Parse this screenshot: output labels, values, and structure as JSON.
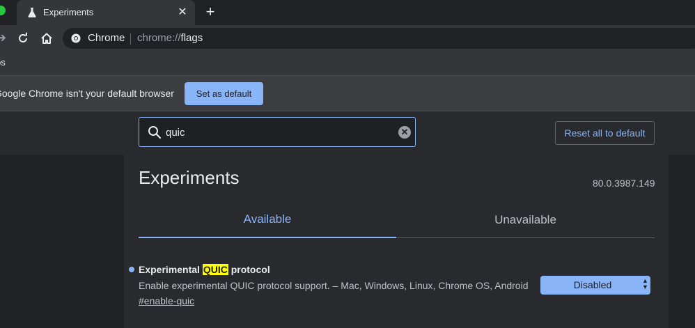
{
  "tab": {
    "title": "Experiments",
    "close": "✕"
  },
  "new_tab": "+",
  "omnibox": {
    "chip_label": "Chrome",
    "url_scheme": "chrome://",
    "url_path": "flags"
  },
  "bookmarks": {
    "apps_label": "ps"
  },
  "infobar": {
    "message": "Google Chrome isn't your default browser",
    "button_label": "Set as default"
  },
  "search": {
    "value": "quic",
    "clear": "✕"
  },
  "reset_label": "Reset all to default",
  "page": {
    "title": "Experiments",
    "version": "80.0.3987.149",
    "tabs": [
      {
        "label": "Available",
        "active": true
      },
      {
        "label": "Unavailable",
        "active": false
      }
    ]
  },
  "flag": {
    "name_prefix": "Experimental ",
    "name_highlight": "QUIC",
    "name_suffix": " protocol",
    "description": "Enable experimental QUIC protocol support. – Mac, Windows, Linux, Chrome OS, Android",
    "link": "#enable-quic",
    "select_value": "Disabled"
  },
  "colors": {
    "accent": "#8ab4f8",
    "background": "#292a2d",
    "highlight": "#ffff00"
  }
}
